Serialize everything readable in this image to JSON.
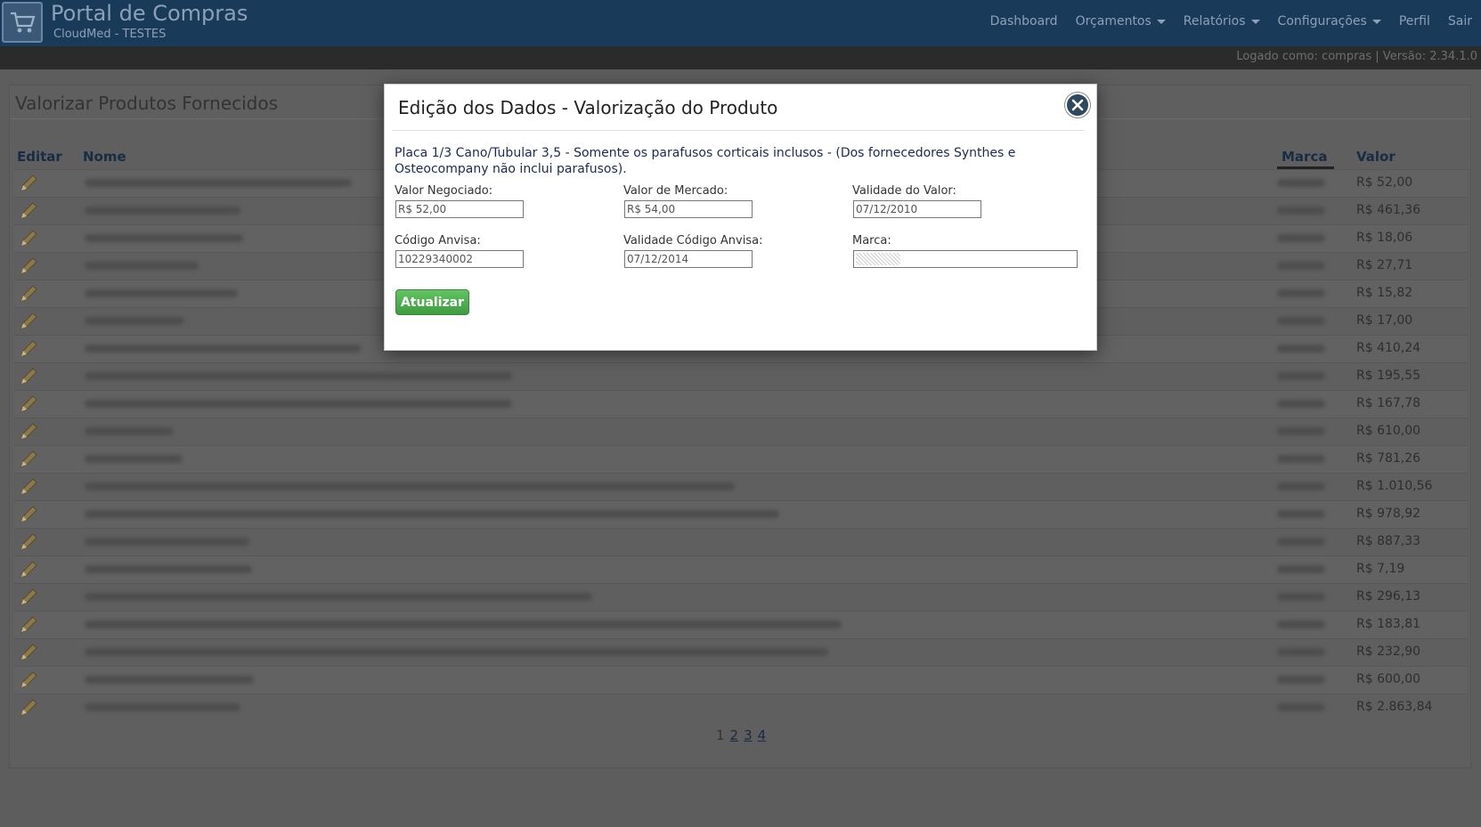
{
  "header": {
    "title": "Portal de Compras",
    "subtitle": "CloudMed - TESTES",
    "nav": [
      {
        "label": "Dashboard",
        "dropdown": false
      },
      {
        "label": "Orçamentos",
        "dropdown": true
      },
      {
        "label": "Relatórios",
        "dropdown": true
      },
      {
        "label": "Configurações",
        "dropdown": true
      },
      {
        "label": "Perfil",
        "dropdown": false
      },
      {
        "label": "Sair",
        "dropdown": false
      }
    ]
  },
  "status_bar": {
    "text": "Logado como: compras | Versão: 2.34.1.0"
  },
  "page": {
    "title": "Valorizar Produtos Fornecidos",
    "columns": {
      "edit": "Editar",
      "name": "Nome",
      "brand": "Marca",
      "value": "Valor"
    },
    "values": [
      "R$ 52,00",
      "R$ 461,36",
      "R$ 18,06",
      "R$ 27,71",
      "R$ 15,82",
      "R$ 17,00",
      "R$ 410,24",
      "R$ 195,55",
      "R$ 167,78",
      "R$ 610,00",
      "R$ 781,26",
      "R$ 1.010,56",
      "R$ 978,92",
      "R$ 887,33",
      "R$ 7,19",
      "R$ 296,13",
      "R$ 183,81",
      "R$ 232,90",
      "R$ 600,00",
      "R$ 2.863,84"
    ],
    "pagination": {
      "current": "1",
      "pages": [
        "2",
        "3",
        "4"
      ]
    }
  },
  "modal": {
    "title": "Edição dos Dados - Valorização do Produto",
    "description": "Placa 1/3 Cano/Tubular 3,5 - Somente os parafusos corticais inclusos - (Dos fornecedores Synthes e Osteocompany não inclui parafusos).",
    "fields": {
      "valor_negociado": {
        "label": "Valor Negociado:",
        "value": "R$ 52,00"
      },
      "valor_mercado": {
        "label": "Valor de Mercado:",
        "value": "R$ 54,00"
      },
      "validade_valor": {
        "label": "Validade do Valor:",
        "value": "07/12/2010"
      },
      "codigo_anvisa": {
        "label": "Código Anvisa:",
        "value": "10229340002"
      },
      "validade_anvisa": {
        "label": "Validade Código Anvisa:",
        "value": "07/12/2014"
      },
      "marca": {
        "label": "Marca:",
        "value": ""
      }
    },
    "submit_label": "Atualizar"
  }
}
